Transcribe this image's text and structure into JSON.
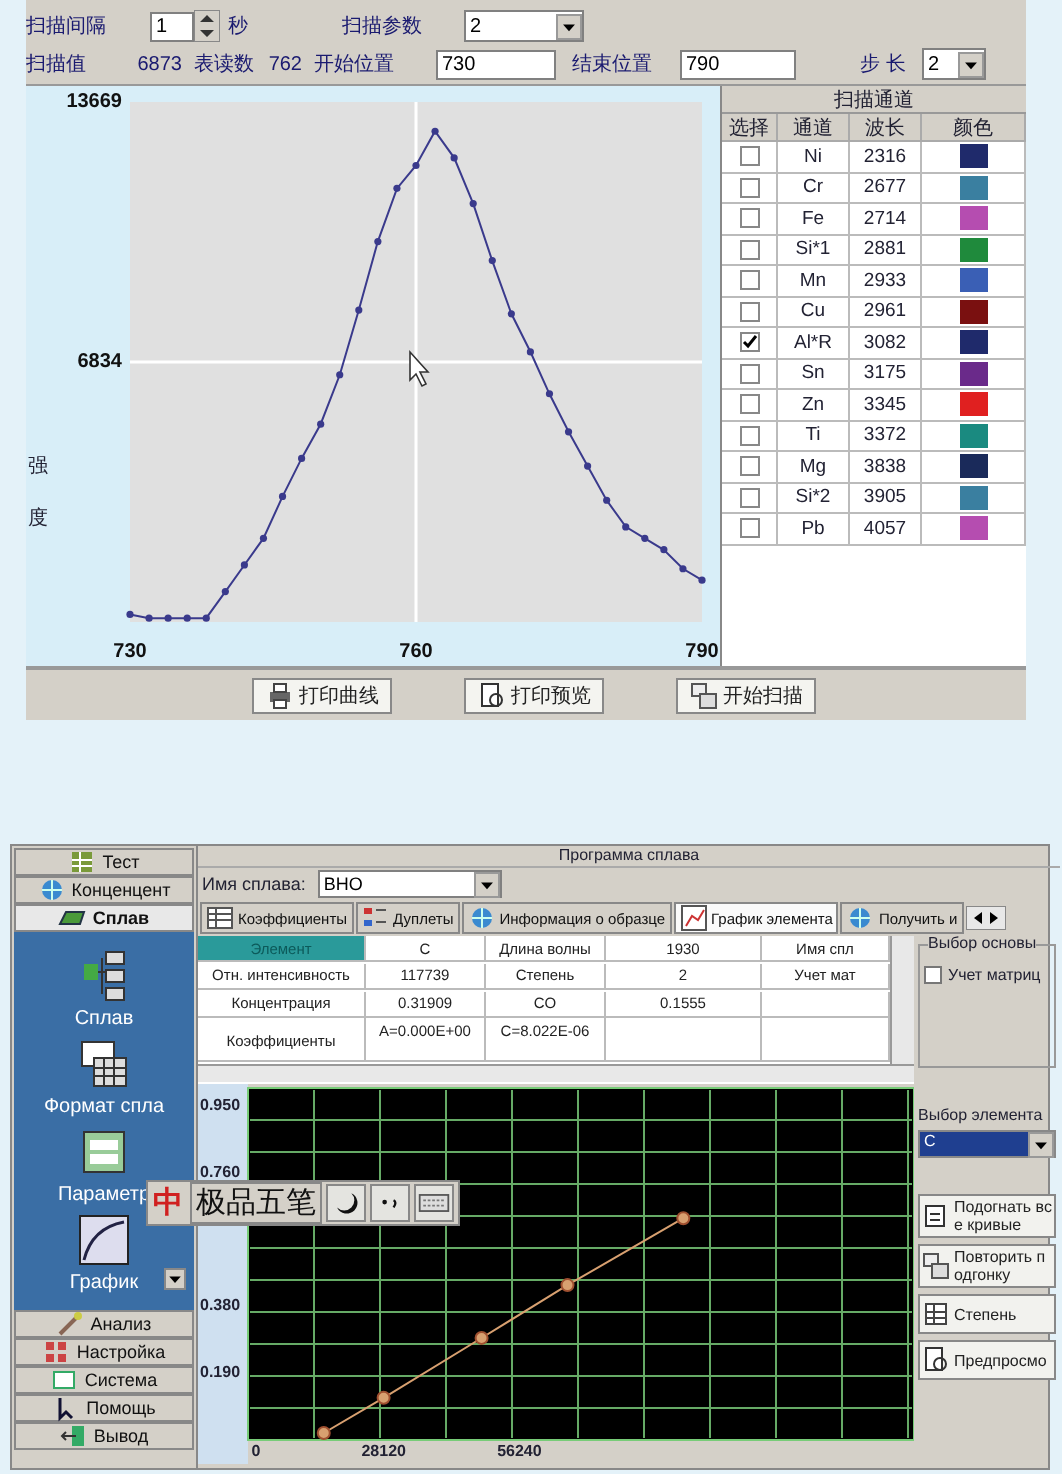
{
  "scan_window": {
    "controls": {
      "interval_label": "扫描间隔",
      "interval_value": "1",
      "interval_unit": "秒",
      "param_label": "扫描参数",
      "param_value": "2",
      "scan_value_label": "扫描值",
      "scan_value": "6873",
      "reading_label": "表读数",
      "reading": "762",
      "start_label": "开始位置",
      "start_value": "730",
      "end_label": "结束位置",
      "end_value": "790",
      "step_label": "步 长",
      "step_value": "2"
    },
    "chart": {
      "chart_data": {
        "type": "line",
        "ylabel": "强度",
        "x": [
          730,
          732,
          734,
          736,
          738,
          740,
          742,
          744,
          746,
          748,
          750,
          752,
          754,
          756,
          758,
          760,
          762,
          764,
          766,
          768,
          770,
          772,
          774,
          776,
          778,
          780,
          782,
          784,
          786,
          788,
          790
        ],
        "series": [
          {
            "color": "#3a3a8c",
            "marker": "circle",
            "values": [
              200,
              100,
              100,
              100,
              100,
              800,
              1500,
              2200,
              3300,
              4300,
              5200,
              6500,
              8200,
              10000,
              11400,
              12000,
              12900,
              12200,
              11000,
              9500,
              8100,
              7100,
              6000,
              5000,
              4100,
              3200,
              2500,
              2200,
              1900,
              1400,
              1100
            ]
          }
        ],
        "xticks": [
          730,
          760,
          790
        ],
        "yticks": [
          {
            "value": 6834,
            "label": "6834"
          },
          {
            "value": 13669,
            "label": "13669"
          }
        ],
        "xlim": [
          730,
          790
        ],
        "ylim": [
          0,
          13669
        ]
      }
    },
    "channels": {
      "title": "扫描通道",
      "columns": [
        "选择",
        "通道",
        "波长",
        "颜色"
      ],
      "rows": [
        {
          "checked": false,
          "name": "Ni",
          "wavelength": "2316",
          "color": "#1f2a6b"
        },
        {
          "checked": false,
          "name": "Cr",
          "wavelength": "2677",
          "color": "#3a7fa0"
        },
        {
          "checked": false,
          "name": "Fe",
          "wavelength": "2714",
          "color": "#b54db0"
        },
        {
          "checked": false,
          "name": "Si*1",
          "wavelength": "2881",
          "color": "#1f8a3c"
        },
        {
          "checked": false,
          "name": "Mn",
          "wavelength": "2933",
          "color": "#3a5fb5"
        },
        {
          "checked": false,
          "name": "Cu",
          "wavelength": "2961",
          "color": "#7a1010"
        },
        {
          "checked": true,
          "name": "Al*R",
          "wavelength": "3082",
          "color": "#1f2a6b"
        },
        {
          "checked": false,
          "name": "Sn",
          "wavelength": "3175",
          "color": "#6a2a8a"
        },
        {
          "checked": false,
          "name": "Zn",
          "wavelength": "3345",
          "color": "#e02020"
        },
        {
          "checked": false,
          "name": "Ti",
          "wavelength": "3372",
          "color": "#1a8a80"
        },
        {
          "checked": false,
          "name": "Mg",
          "wavelength": "3838",
          "color": "#1a2a5a"
        },
        {
          "checked": false,
          "name": "Si*2",
          "wavelength": "3905",
          "color": "#3a7fa0"
        },
        {
          "checked": false,
          "name": "Pb",
          "wavelength": "4057",
          "color": "#b54db0"
        }
      ]
    },
    "buttons": [
      "打印曲线",
      "打印预览",
      "开始扫描"
    ]
  },
  "alloy_window": {
    "nav_top": [
      {
        "label": "Тест",
        "selected": false
      },
      {
        "label": "Конценцент",
        "selected": false
      },
      {
        "label": "Сплав",
        "selected": true
      }
    ],
    "nav_panel": [
      {
        "label": "Сплав",
        "has_menu": false
      },
      {
        "label": "Формат спла",
        "has_menu": false
      },
      {
        "label": "Параметр",
        "has_menu": false
      },
      {
        "label": "График",
        "has_menu": true
      }
    ],
    "nav_bottom": [
      {
        "label": "Анализ",
        "selected": false
      },
      {
        "label": "Настройка",
        "selected": false
      },
      {
        "label": "Система",
        "selected": false
      },
      {
        "label": "Помощь",
        "selected": false
      },
      {
        "label": "Вывод",
        "selected": false
      }
    ],
    "title": "Программа сплава",
    "alloy_name": {
      "label": "Имя сплава:",
      "value": "ВНО"
    },
    "tabs": [
      {
        "label": "Коэффициенты",
        "selected": false
      },
      {
        "label": "Дуплеты",
        "selected": false
      },
      {
        "label": "Информация о образце",
        "selected": false
      },
      {
        "label": "График элемента",
        "selected": true
      },
      {
        "label": "Получить и",
        "selected": false
      }
    ],
    "table": {
      "rows": [
        {
          "label": {
            "text": "Элемент",
            "selected": true
          },
          "cells": [
            "C",
            "Длина волны",
            "1930",
            "Имя спл"
          ]
        },
        {
          "label": {
            "text": "Отн. интенсивность",
            "selected": false
          },
          "cells": [
            "117739",
            "Степень",
            "2",
            "Учет мат"
          ]
        },
        {
          "label": {
            "text": "Концентрация",
            "selected": false
          },
          "cells": [
            "0.31909",
            "CO",
            "0.1555",
            ""
          ]
        },
        {
          "label": {
            "text": "Коэффициенты",
            "selected": false
          },
          "cells": [
            "A=0.000E+00",
            "C=8.022E-06",
            "",
            ""
          ]
        }
      ]
    },
    "basis_group": {
      "title": "Выбор основы",
      "checkbox": {
        "label": "Учет матриц",
        "checked": false
      }
    },
    "element_select": {
      "label": "Выбор элемента",
      "value": "C"
    },
    "actions": [
      {
        "lines": [
          "Подогнать вс",
          "е кривые"
        ]
      },
      {
        "lines": [
          "Повторить п",
          "одгонку"
        ]
      },
      {
        "lines": [
          "Степень"
        ]
      },
      {
        "lines": [
          "Предпросмо"
        ]
      }
    ],
    "chart": {
      "chart_data": {
        "type": "line",
        "x": [
          15700,
          28100,
          48400,
          66200,
          90200
        ],
        "series": [
          {
            "color": "#d8a070",
            "marker": "circle",
            "values": [
              0.02,
              0.12,
              0.29,
              0.44,
              0.63
            ]
          }
        ],
        "grid": true,
        "xticks": [
          0,
          28120,
          56240
        ],
        "yticks": [
          {
            "value": 0.19,
            "label": "0.190"
          },
          {
            "value": 0.38,
            "label": "0.380"
          },
          {
            "value": 0.76,
            "label": "0.760"
          },
          {
            "value": 0.95,
            "label": "0.950"
          }
        ],
        "xlim": [
          0,
          138000
        ],
        "ylim": [
          0,
          1.0
        ]
      }
    }
  },
  "ime_bar": {
    "logo": "中",
    "name": "极品五笔"
  }
}
